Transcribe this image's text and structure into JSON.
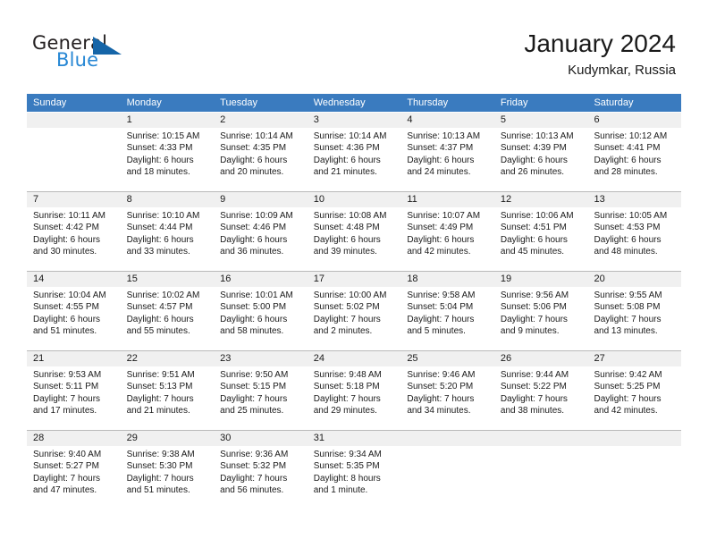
{
  "brand": {
    "name_top": "General",
    "name_bottom": "Blue",
    "triangle_icon": "triangle-icon",
    "color_dark": "#231f20",
    "color_blue": "#2787d4",
    "color_triangle": "#1565a8"
  },
  "header": {
    "title": "January 2024",
    "subtitle": "Kudymkar, Russia"
  },
  "theme": {
    "header_bar": "#3a7bbf",
    "daynum_band": "#f0f0f0",
    "cell_bg": "#ffffff",
    "separator": "#b9b9b9",
    "text": "#1a1a1a"
  },
  "weekdays": [
    "Sunday",
    "Monday",
    "Tuesday",
    "Wednesday",
    "Thursday",
    "Friday",
    "Saturday"
  ],
  "weeks": [
    [
      {
        "day": "",
        "sunrise": "",
        "sunset": "",
        "daylight_1": "",
        "daylight_2": ""
      },
      {
        "day": "1",
        "sunrise": "Sunrise: 10:15 AM",
        "sunset": "Sunset: 4:33 PM",
        "daylight_1": "Daylight: 6 hours",
        "daylight_2": "and 18 minutes."
      },
      {
        "day": "2",
        "sunrise": "Sunrise: 10:14 AM",
        "sunset": "Sunset: 4:35 PM",
        "daylight_1": "Daylight: 6 hours",
        "daylight_2": "and 20 minutes."
      },
      {
        "day": "3",
        "sunrise": "Sunrise: 10:14 AM",
        "sunset": "Sunset: 4:36 PM",
        "daylight_1": "Daylight: 6 hours",
        "daylight_2": "and 21 minutes."
      },
      {
        "day": "4",
        "sunrise": "Sunrise: 10:13 AM",
        "sunset": "Sunset: 4:37 PM",
        "daylight_1": "Daylight: 6 hours",
        "daylight_2": "and 24 minutes."
      },
      {
        "day": "5",
        "sunrise": "Sunrise: 10:13 AM",
        "sunset": "Sunset: 4:39 PM",
        "daylight_1": "Daylight: 6 hours",
        "daylight_2": "and 26 minutes."
      },
      {
        "day": "6",
        "sunrise": "Sunrise: 10:12 AM",
        "sunset": "Sunset: 4:41 PM",
        "daylight_1": "Daylight: 6 hours",
        "daylight_2": "and 28 minutes."
      }
    ],
    [
      {
        "day": "7",
        "sunrise": "Sunrise: 10:11 AM",
        "sunset": "Sunset: 4:42 PM",
        "daylight_1": "Daylight: 6 hours",
        "daylight_2": "and 30 minutes."
      },
      {
        "day": "8",
        "sunrise": "Sunrise: 10:10 AM",
        "sunset": "Sunset: 4:44 PM",
        "daylight_1": "Daylight: 6 hours",
        "daylight_2": "and 33 minutes."
      },
      {
        "day": "9",
        "sunrise": "Sunrise: 10:09 AM",
        "sunset": "Sunset: 4:46 PM",
        "daylight_1": "Daylight: 6 hours",
        "daylight_2": "and 36 minutes."
      },
      {
        "day": "10",
        "sunrise": "Sunrise: 10:08 AM",
        "sunset": "Sunset: 4:48 PM",
        "daylight_1": "Daylight: 6 hours",
        "daylight_2": "and 39 minutes."
      },
      {
        "day": "11",
        "sunrise": "Sunrise: 10:07 AM",
        "sunset": "Sunset: 4:49 PM",
        "daylight_1": "Daylight: 6 hours",
        "daylight_2": "and 42 minutes."
      },
      {
        "day": "12",
        "sunrise": "Sunrise: 10:06 AM",
        "sunset": "Sunset: 4:51 PM",
        "daylight_1": "Daylight: 6 hours",
        "daylight_2": "and 45 minutes."
      },
      {
        "day": "13",
        "sunrise": "Sunrise: 10:05 AM",
        "sunset": "Sunset: 4:53 PM",
        "daylight_1": "Daylight: 6 hours",
        "daylight_2": "and 48 minutes."
      }
    ],
    [
      {
        "day": "14",
        "sunrise": "Sunrise: 10:04 AM",
        "sunset": "Sunset: 4:55 PM",
        "daylight_1": "Daylight: 6 hours",
        "daylight_2": "and 51 minutes."
      },
      {
        "day": "15",
        "sunrise": "Sunrise: 10:02 AM",
        "sunset": "Sunset: 4:57 PM",
        "daylight_1": "Daylight: 6 hours",
        "daylight_2": "and 55 minutes."
      },
      {
        "day": "16",
        "sunrise": "Sunrise: 10:01 AM",
        "sunset": "Sunset: 5:00 PM",
        "daylight_1": "Daylight: 6 hours",
        "daylight_2": "and 58 minutes."
      },
      {
        "day": "17",
        "sunrise": "Sunrise: 10:00 AM",
        "sunset": "Sunset: 5:02 PM",
        "daylight_1": "Daylight: 7 hours",
        "daylight_2": "and 2 minutes."
      },
      {
        "day": "18",
        "sunrise": "Sunrise: 9:58 AM",
        "sunset": "Sunset: 5:04 PM",
        "daylight_1": "Daylight: 7 hours",
        "daylight_2": "and 5 minutes."
      },
      {
        "day": "19",
        "sunrise": "Sunrise: 9:56 AM",
        "sunset": "Sunset: 5:06 PM",
        "daylight_1": "Daylight: 7 hours",
        "daylight_2": "and 9 minutes."
      },
      {
        "day": "20",
        "sunrise": "Sunrise: 9:55 AM",
        "sunset": "Sunset: 5:08 PM",
        "daylight_1": "Daylight: 7 hours",
        "daylight_2": "and 13 minutes."
      }
    ],
    [
      {
        "day": "21",
        "sunrise": "Sunrise: 9:53 AM",
        "sunset": "Sunset: 5:11 PM",
        "daylight_1": "Daylight: 7 hours",
        "daylight_2": "and 17 minutes."
      },
      {
        "day": "22",
        "sunrise": "Sunrise: 9:51 AM",
        "sunset": "Sunset: 5:13 PM",
        "daylight_1": "Daylight: 7 hours",
        "daylight_2": "and 21 minutes."
      },
      {
        "day": "23",
        "sunrise": "Sunrise: 9:50 AM",
        "sunset": "Sunset: 5:15 PM",
        "daylight_1": "Daylight: 7 hours",
        "daylight_2": "and 25 minutes."
      },
      {
        "day": "24",
        "sunrise": "Sunrise: 9:48 AM",
        "sunset": "Sunset: 5:18 PM",
        "daylight_1": "Daylight: 7 hours",
        "daylight_2": "and 29 minutes."
      },
      {
        "day": "25",
        "sunrise": "Sunrise: 9:46 AM",
        "sunset": "Sunset: 5:20 PM",
        "daylight_1": "Daylight: 7 hours",
        "daylight_2": "and 34 minutes."
      },
      {
        "day": "26",
        "sunrise": "Sunrise: 9:44 AM",
        "sunset": "Sunset: 5:22 PM",
        "daylight_1": "Daylight: 7 hours",
        "daylight_2": "and 38 minutes."
      },
      {
        "day": "27",
        "sunrise": "Sunrise: 9:42 AM",
        "sunset": "Sunset: 5:25 PM",
        "daylight_1": "Daylight: 7 hours",
        "daylight_2": "and 42 minutes."
      }
    ],
    [
      {
        "day": "28",
        "sunrise": "Sunrise: 9:40 AM",
        "sunset": "Sunset: 5:27 PM",
        "daylight_1": "Daylight: 7 hours",
        "daylight_2": "and 47 minutes."
      },
      {
        "day": "29",
        "sunrise": "Sunrise: 9:38 AM",
        "sunset": "Sunset: 5:30 PM",
        "daylight_1": "Daylight: 7 hours",
        "daylight_2": "and 51 minutes."
      },
      {
        "day": "30",
        "sunrise": "Sunrise: 9:36 AM",
        "sunset": "Sunset: 5:32 PM",
        "daylight_1": "Daylight: 7 hours",
        "daylight_2": "and 56 minutes."
      },
      {
        "day": "31",
        "sunrise": "Sunrise: 9:34 AM",
        "sunset": "Sunset: 5:35 PM",
        "daylight_1": "Daylight: 8 hours",
        "daylight_2": "and 1 minute."
      },
      {
        "day": "",
        "sunrise": "",
        "sunset": "",
        "daylight_1": "",
        "daylight_2": ""
      },
      {
        "day": "",
        "sunrise": "",
        "sunset": "",
        "daylight_1": "",
        "daylight_2": ""
      },
      {
        "day": "",
        "sunrise": "",
        "sunset": "",
        "daylight_1": "",
        "daylight_2": ""
      }
    ]
  ]
}
